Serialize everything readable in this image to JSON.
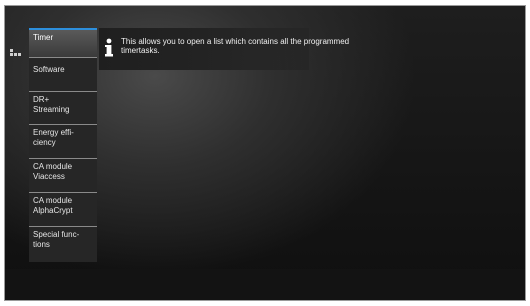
{
  "menu": {
    "items": [
      {
        "line1": "Timer",
        "line2": "",
        "active": true
      },
      {
        "line1": "Software",
        "line2": "",
        "active": false
      },
      {
        "line1": "DR+",
        "line2": "Streaming",
        "active": false
      },
      {
        "line1": "Energy effi-",
        "line2": "ciency",
        "active": false
      },
      {
        "line1": "CA module",
        "line2": "Viaccess",
        "active": false
      },
      {
        "line1": "CA module",
        "line2": "AlphaCrypt",
        "active": false
      },
      {
        "line1": "Special func-",
        "line2": "tions",
        "active": false
      }
    ]
  },
  "info": {
    "icon": "info-icon",
    "line1": "This allows you to open a list which contains all the programmed",
    "line2": "timertasks."
  },
  "side": {
    "icon": "tree-menu-icon"
  },
  "colors": {
    "accent": "#2d8fdc",
    "background": "#1a1a1a",
    "menu_background": "#262626"
  }
}
